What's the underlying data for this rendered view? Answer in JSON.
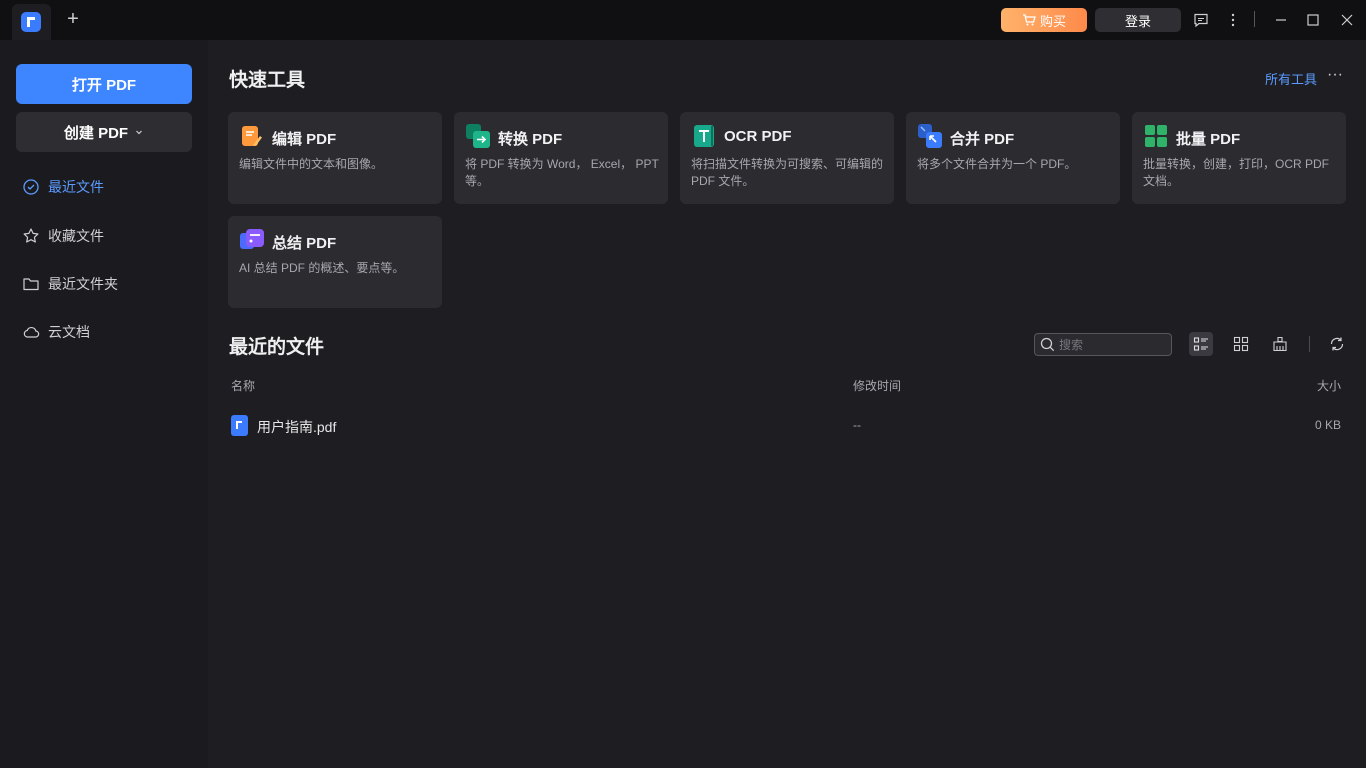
{
  "titlebar": {
    "buy_label": "购买",
    "login_label": "登录"
  },
  "sidebar": {
    "open_label": "打开 PDF",
    "create_label": "创建 PDF",
    "items": [
      {
        "label": "最近文件",
        "icon": "clock-icon",
        "active": true
      },
      {
        "label": "收藏文件",
        "icon": "star-icon",
        "active": false
      },
      {
        "label": "最近文件夹",
        "icon": "folder-icon",
        "active": false
      },
      {
        "label": "云文档",
        "icon": "cloud-icon",
        "active": false
      }
    ]
  },
  "quick_tools": {
    "title": "快速工具",
    "all_tools_label": "所有工具",
    "tools": [
      {
        "name": "编辑 PDF",
        "desc": "编辑文件中的文本和图像。",
        "icon": "edit-pdf-icon",
        "color": "#ff9a3c"
      },
      {
        "name": "转换 PDF",
        "desc": "将 PDF 转换为 Word， Excel， PPT等。",
        "icon": "convert-pdf-icon",
        "color": "#1fb58a"
      },
      {
        "name": "OCR PDF",
        "desc": "将扫描文件转换为可搜索、可编辑的 PDF 文件。",
        "icon": "ocr-pdf-icon",
        "color": "#17a98a"
      },
      {
        "name": "合并 PDF",
        "desc": "将多个文件合并为一个 PDF。",
        "icon": "merge-pdf-icon",
        "color": "#3b7cff"
      },
      {
        "name": "批量 PDF",
        "desc": "批量转换，创建，打印，OCR PDF 文档。",
        "icon": "batch-pdf-icon",
        "color": "#2fb36a"
      },
      {
        "name": "总结 PDF",
        "desc": "AI 总结 PDF 的概述、要点等。",
        "icon": "summarize-pdf-icon",
        "color": "#8a5cff"
      }
    ]
  },
  "recent": {
    "title": "最近的文件",
    "search_placeholder": "搜索",
    "columns": {
      "name": "名称",
      "modified": "修改时间",
      "size": "大小"
    },
    "files": [
      {
        "name": "用户指南.pdf",
        "modified": "--",
        "size": "0 KB"
      }
    ]
  }
}
